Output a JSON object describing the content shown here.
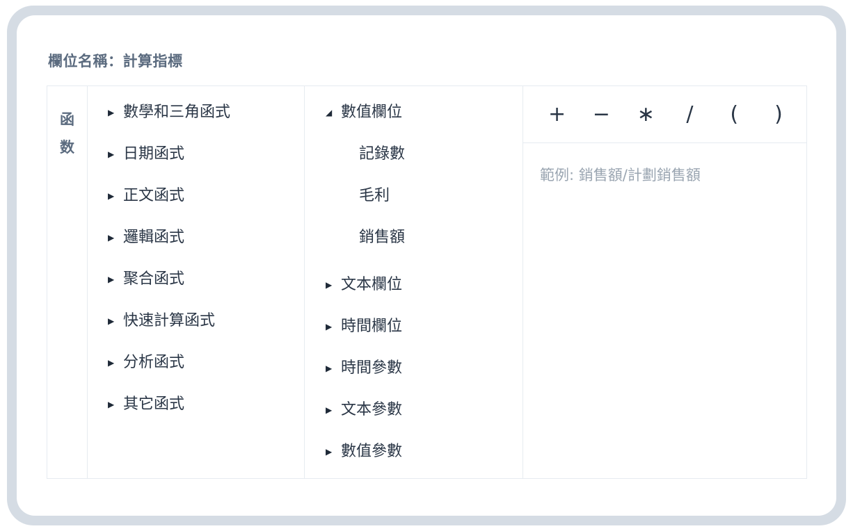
{
  "field_name": "欄位名稱：計算指標",
  "tab": {
    "label_line1": "函",
    "label_line2": "数"
  },
  "functions": [
    {
      "label": "數學和三角函式"
    },
    {
      "label": "日期函式"
    },
    {
      "label": "正文函式"
    },
    {
      "label": "邏輯函式"
    },
    {
      "label": "聚合函式"
    },
    {
      "label": "快速計算函式"
    },
    {
      "label": "分析函式"
    },
    {
      "label": "其它函式"
    }
  ],
  "fields": {
    "expanded": {
      "label": "數值欄位",
      "children": [
        "記錄數",
        "毛利",
        "銷售額"
      ]
    },
    "collapsed": [
      {
        "label": "文本欄位"
      },
      {
        "label": "時間欄位"
      },
      {
        "label": "時間參數"
      },
      {
        "label": "文本參數"
      },
      {
        "label": "數值參數"
      }
    ]
  },
  "operators": [
    "+",
    "−",
    "∗",
    "/",
    "(",
    ")"
  ],
  "formula": {
    "value": "",
    "placeholder": "範例: 銷售額/計劃銷售額"
  },
  "icons": {
    "collapsed": "caret-right-icon",
    "expanded": "caret-down-icon"
  }
}
